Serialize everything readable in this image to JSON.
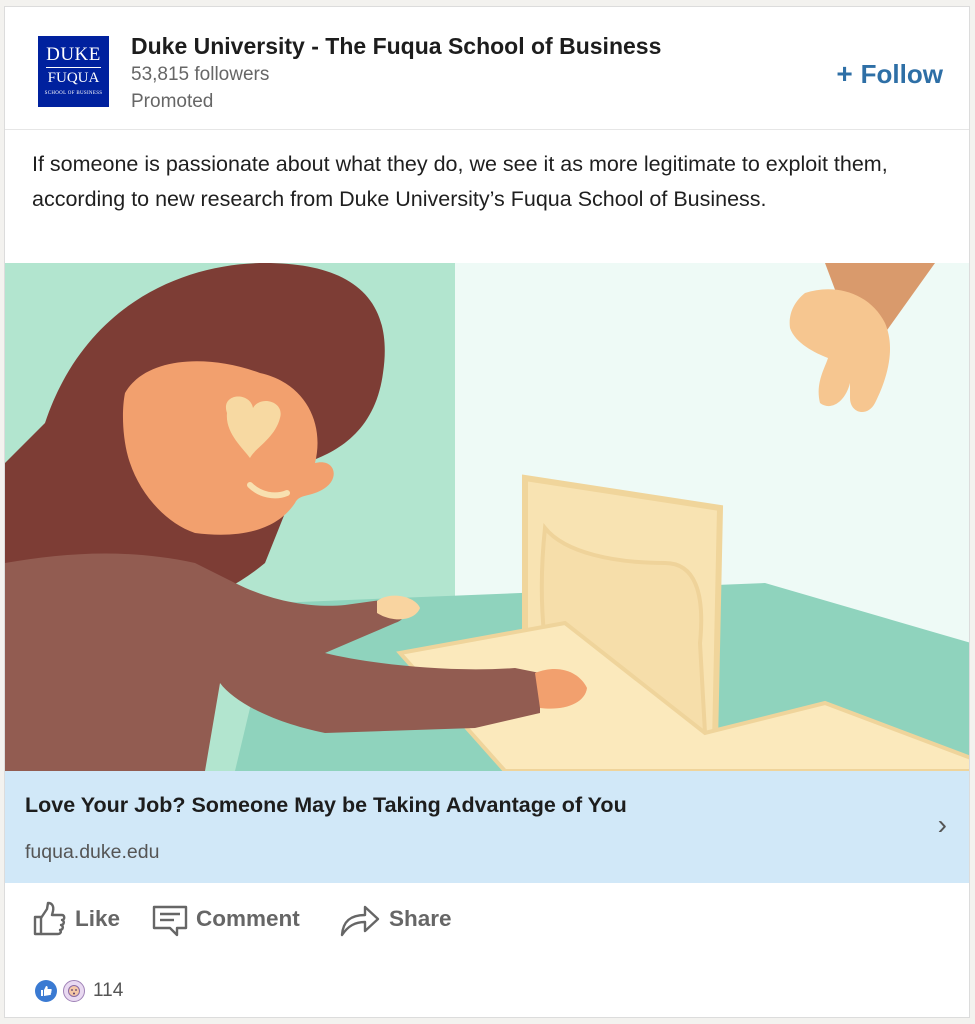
{
  "post": {
    "org_name": "Duke University - The Fuqua School of Business",
    "followers": "53,815 followers",
    "promoted": "Promoted",
    "follow_label": "Follow",
    "follow_icon": "+",
    "logo": {
      "line1": "DUKE",
      "line2": "FUQUA",
      "line3": "SCHOOL OF BUSINESS"
    },
    "body_text": "If someone is passionate about what they do, we see it as more legitimate to exploit them, according to new research from Duke University’s Fuqua School of Business."
  },
  "link_preview": {
    "title": "Love Your Job? Someone May be Taking Advantage of You",
    "domain": "fuqua.duke.edu",
    "chevron": "›"
  },
  "actions": {
    "like": "Like",
    "comment": "Comment",
    "share": "Share"
  },
  "reactions": {
    "count": "114",
    "icons": [
      "like-reaction-icon",
      "curious-reaction-icon"
    ]
  },
  "colors": {
    "brand_blue": "#00219e",
    "follow_blue": "#2e6fa6",
    "link_bar": "#d1e8f8",
    "hero_mint": "#b2e5cf",
    "hair": "#7d3d35"
  }
}
